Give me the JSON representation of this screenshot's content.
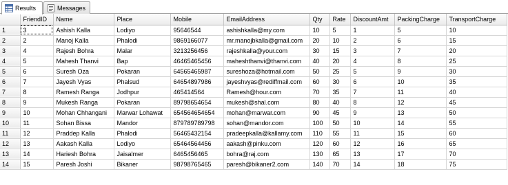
{
  "tabs": [
    {
      "label": "Results",
      "icon": "grid-results-icon"
    },
    {
      "label": "Messages",
      "icon": "messages-icon"
    }
  ],
  "columns": [
    "FriendID",
    "Name",
    "Place",
    "Mobile",
    "EmailAddress",
    "Qty",
    "Rate",
    "DiscountAmt",
    "PackingCharge",
    "TransportCharge"
  ],
  "rows": [
    [
      "1",
      "3",
      "Ashish Kalla",
      "Lodiyo",
      "95646544",
      "ashishkalla@my.com",
      "10",
      "5",
      "1",
      "5",
      "10"
    ],
    [
      "2",
      "2",
      "Manoj Kalla",
      "Phalodi",
      "9869166077",
      "mr.manojbkalla@gmail.com",
      "20",
      "10",
      "2",
      "6",
      "15"
    ],
    [
      "3",
      "4",
      "Rajesh Bohra",
      "Malar",
      "3213256456",
      "rajeshkalla@your.com",
      "30",
      "15",
      "3",
      "7",
      "20"
    ],
    [
      "4",
      "5",
      "Mahesh Thanvi",
      "Bap",
      "46465465456",
      "maheshthanvi@thanvi.com",
      "40",
      "20",
      "4",
      "8",
      "25"
    ],
    [
      "5",
      "6",
      "Suresh Oza",
      "Pokaran",
      "6456546​5987",
      "sureshoza@hotmail.com",
      "50",
      "25",
      "5",
      "9",
      "30"
    ],
    [
      "6",
      "7",
      "Jayesh Vyas",
      "Phalsud",
      "64654897986",
      "jayeshvyas@rediffmail.com",
      "60",
      "30",
      "6",
      "10",
      "35"
    ],
    [
      "7",
      "8",
      "Ramesh Ranga",
      "Jodhpur",
      "465414564",
      "Ramesh@hour.com",
      "70",
      "35",
      "7",
      "11",
      "40"
    ],
    [
      "8",
      "9",
      "Mukesh Ranga",
      "Pokaran",
      "89798654654",
      "mukesh@shal.com",
      "80",
      "40",
      "8",
      "12",
      "45"
    ],
    [
      "9",
      "10",
      "Mohan Chhangani",
      "Marwar Lohawat",
      "654564654654",
      "mohan@marwar.com",
      "90",
      "45",
      "9",
      "13",
      "50"
    ],
    [
      "10",
      "11",
      "Sohan Bissa",
      "Mandor",
      "879789789798",
      "sohan@mandor.com",
      "100",
      "50",
      "10",
      "14",
      "55"
    ],
    [
      "11",
      "12",
      "Praddep Kalla",
      "Phalodi",
      "56465432154",
      "pradeepkalla@kallamy.com",
      "110",
      "55",
      "11",
      "15",
      "60"
    ],
    [
      "12",
      "13",
      "Aakash Kalla",
      "Lodiyo",
      "65464564456",
      "aakash@pinku.com",
      "120",
      "60",
      "12",
      "16",
      "65"
    ],
    [
      "13",
      "14",
      "Hariesh Bohra",
      "Jaisalmer",
      "6465456465",
      "bohra@raj.com",
      "130",
      "65",
      "13",
      "17",
      "70"
    ],
    [
      "14",
      "15",
      "Paresh Joshi",
      "Bikaner",
      "98798765465",
      "paresh@bikaner2.com",
      "140",
      "70",
      "14",
      "18",
      "75"
    ]
  ]
}
